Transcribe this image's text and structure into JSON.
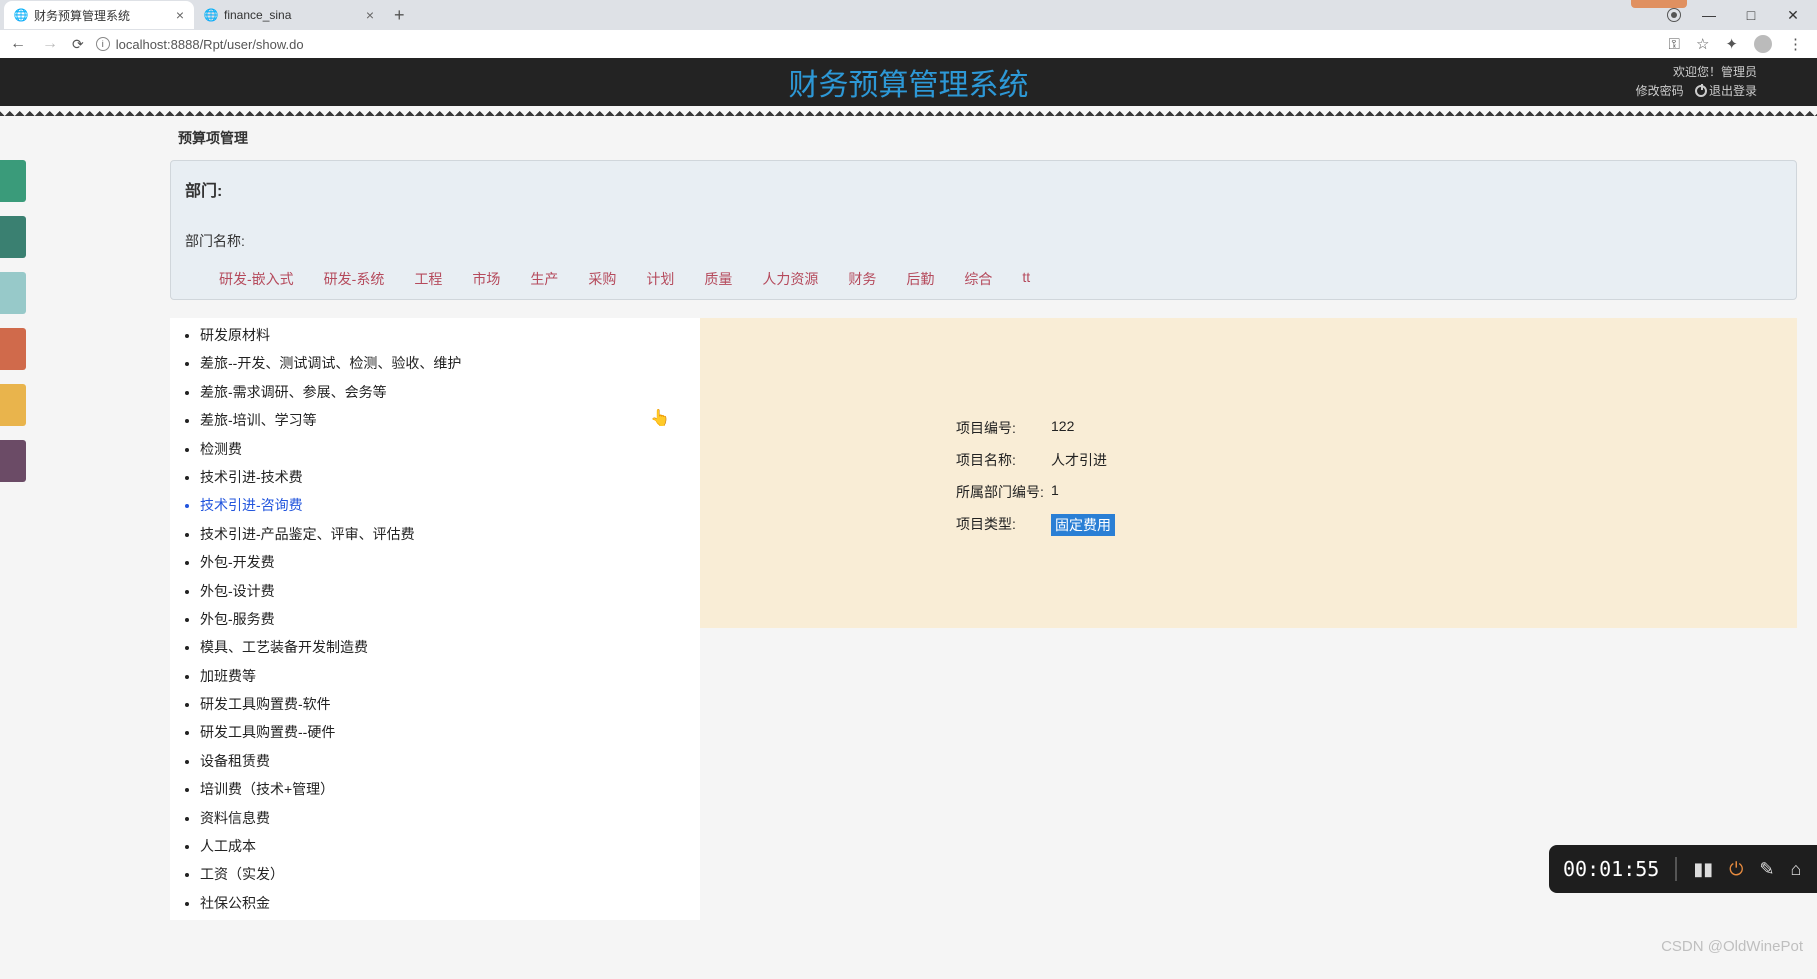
{
  "browser": {
    "tabs": [
      {
        "title": "财务预算管理系统",
        "favicon": "globe",
        "active": true
      },
      {
        "title": "finance_sina",
        "favicon": "globe",
        "active": false
      }
    ],
    "url": "localhost:8888/Rpt/user/show.do"
  },
  "header": {
    "title": "财务预算管理系统",
    "welcome": "欢迎您！管理员",
    "change_pwd": "修改密码",
    "logout": "退出登录"
  },
  "side_colors": [
    "#3a9b7a",
    "#3a8071",
    "#97c9c9",
    "#d06a4b",
    "#e9b44c",
    "#6b4b66"
  ],
  "page": {
    "title": "预算项管理",
    "dept_section_label": "部门:",
    "dept_name_label": "部门名称:",
    "dept_tabs": [
      "研发-嵌入式",
      "研发-系统",
      "工程",
      "市场",
      "生产",
      "采购",
      "计划",
      "质量",
      "人力资源",
      "财务",
      "后勤",
      "综合",
      "tt"
    ]
  },
  "items": [
    {
      "label": "研发原材料",
      "selected": false
    },
    {
      "label": "差旅--开发、测试调试、检测、验收、维护",
      "selected": false
    },
    {
      "label": "差旅-需求调研、参展、会务等",
      "selected": false
    },
    {
      "label": "差旅-培训、学习等",
      "selected": false
    },
    {
      "label": "检测费",
      "selected": false
    },
    {
      "label": "技术引进-技术费",
      "selected": false
    },
    {
      "label": "技术引进-咨询费",
      "selected": true
    },
    {
      "label": "技术引进-产品鉴定、评审、评估费",
      "selected": false
    },
    {
      "label": "外包-开发费",
      "selected": false
    },
    {
      "label": "外包-设计费",
      "selected": false
    },
    {
      "label": "外包-服务费",
      "selected": false
    },
    {
      "label": "模具、工艺装备开发制造费",
      "selected": false
    },
    {
      "label": "加班费等",
      "selected": false
    },
    {
      "label": "研发工具购置费-软件",
      "selected": false
    },
    {
      "label": "研发工具购置费--硬件",
      "selected": false
    },
    {
      "label": "设备租赁费",
      "selected": false
    },
    {
      "label": "培训费（技术+管理）",
      "selected": false
    },
    {
      "label": "资料信息费",
      "selected": false
    },
    {
      "label": "人工成本",
      "selected": false
    },
    {
      "label": "工资（实发）",
      "selected": false
    },
    {
      "label": "社保公积金",
      "selected": false
    }
  ],
  "detail": {
    "fields": [
      {
        "label": "项目编号:",
        "value": "122",
        "hl": false
      },
      {
        "label": "项目名称:",
        "value": "人才引进",
        "hl": false
      },
      {
        "label": "所属部门编号:",
        "value": "1",
        "hl": false
      },
      {
        "label": "项目类型:",
        "value": "固定费用",
        "hl": true
      }
    ]
  },
  "recorder": {
    "time": "00:01:55"
  },
  "watermark": "CSDN @OldWinePot"
}
